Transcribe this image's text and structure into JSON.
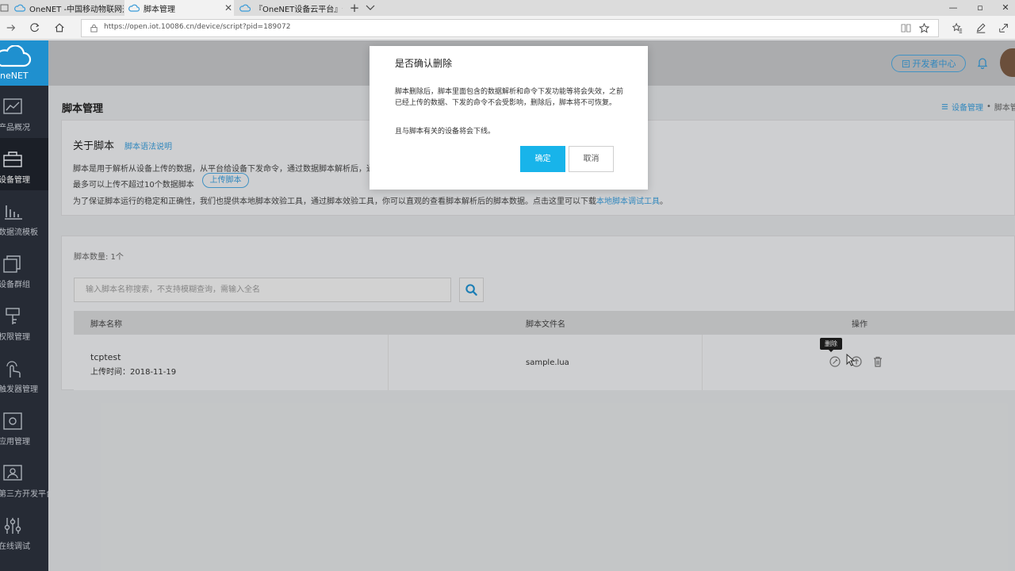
{
  "browser": {
    "tabs": [
      {
        "title": "OneNET -中国移动物联网开",
        "icon": "cloud-icon"
      },
      {
        "title": "脚本管理",
        "icon": "cloud-icon"
      },
      {
        "title": "『OneNET设备云平台』云"
      }
    ],
    "url": "https://open.iot.10086.cn/device/script?pid=189072"
  },
  "sidebar": {
    "logo_text": "neNET",
    "items": [
      {
        "label": "产品概况",
        "icon": "chart-icon"
      },
      {
        "label": "设备管理",
        "icon": "device-icon"
      },
      {
        "label": "数据流模板",
        "icon": "bar-chart-icon"
      },
      {
        "label": "设备群组",
        "icon": "group-icon"
      },
      {
        "label": "权限管理",
        "icon": "key-icon"
      },
      {
        "label": "触发器管理",
        "icon": "trigger-icon"
      },
      {
        "label": "应用管理",
        "icon": "app-icon"
      },
      {
        "label": "第三方开发平台",
        "icon": "platform-icon"
      },
      {
        "label": "在线调试",
        "icon": "debug-icon"
      }
    ]
  },
  "header": {
    "dev_center": "开发者中心"
  },
  "main": {
    "page_title": "脚本管理",
    "breadcrumb": [
      "设备管理",
      "脚本管"
    ],
    "about": {
      "title": "关于脚本",
      "doc_link": "脚本语法说明",
      "line1": "脚本是用于解析从设备上传的数据，从平台给设备下发命令，通过数据脚本解析后，通",
      "line2": "最多可以上传不超过10个数据脚本",
      "upload_btn": "上传脚本",
      "line3": "为了保证脚本运行的稳定和正确性，我们也提供本地脚本效验工具，通过脚本效验工具，你可以直观的查看脚本解析后的脚本数据。点击这里可以下载",
      "tool_link": "本地脚本调试工具",
      "line3_end": "。"
    },
    "list": {
      "count_label": "脚本数量: 1个",
      "search_placeholder": "输入脚本名称搜索，不支持模糊查询，需输入全名",
      "columns": [
        "脚本名称",
        "脚本文件名",
        "操作"
      ],
      "rows": [
        {
          "name": "tcptest",
          "upload_time": "上传时间：2018-11-19",
          "file": "sample.lua"
        }
      ],
      "delete_tooltip": "删除"
    }
  },
  "modal": {
    "title": "是否确认删除",
    "body1": "脚本删除后，脚本里面包含的数据解析和命令下发功能等将会失效，之前已经上传的数据、下发的命令不会受影响，删除后，脚本将不可恢复。",
    "body2": "且与脚本有关的设备将会下线。",
    "confirm": "确定",
    "cancel": "取消"
  },
  "colors": {
    "accent": "#18b4ea",
    "link": "#3a9bd8",
    "sidebar_bg": "#262b35",
    "logo_bg": "#1f90cf"
  }
}
